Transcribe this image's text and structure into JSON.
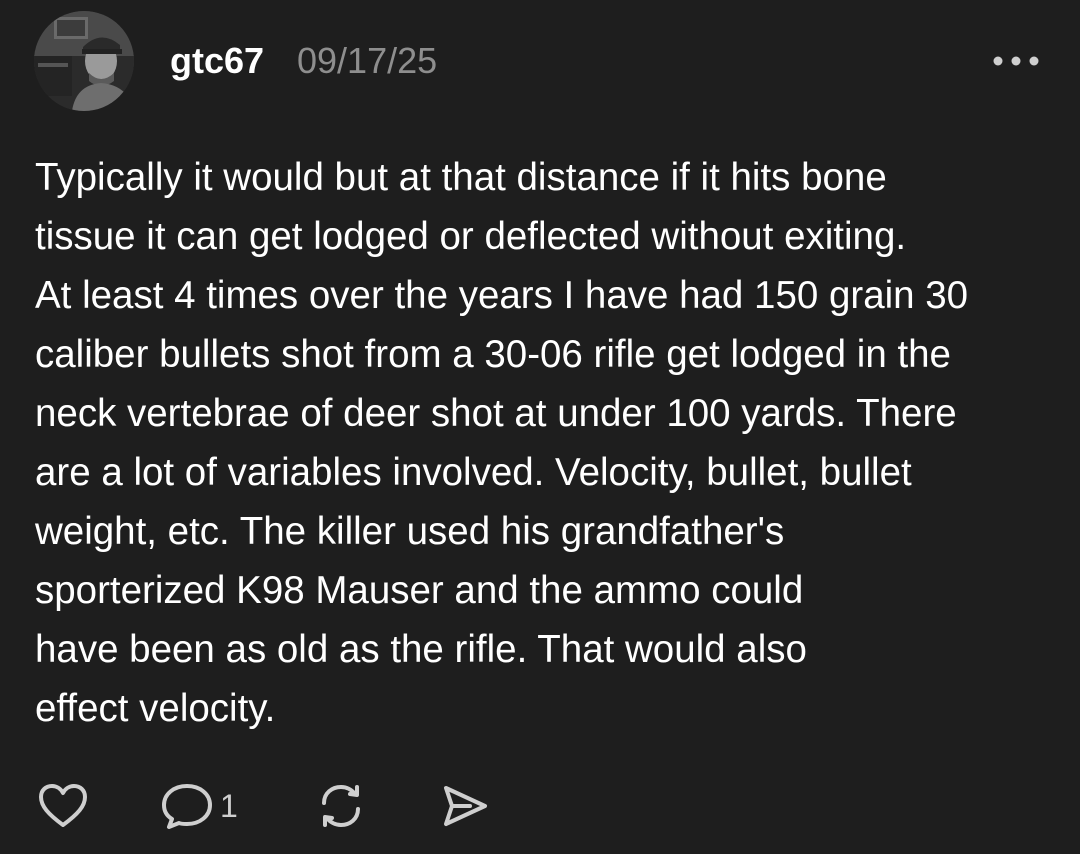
{
  "post": {
    "username": "gtc67",
    "date": "09/17/25",
    "body_lines": [
      "Typically it would but at that distance if it hits bone",
      "tissue it can get lodged or deflected without exiting.",
      "At least 4 times over the years I have had 150 grain 30",
      "caliber bullets shot from a 30-06 rifle get lodged in the",
      "neck vertebrae of deer shot at under 100 yards. There",
      "are a lot of variables involved. Velocity, bullet, bullet",
      "weight, etc. The killer used his grandfather's",
      "sporterized K98 Mauser and the ammo could",
      "have been as old as the rifle. That would also",
      "effect velocity."
    ],
    "reply_count": "1"
  },
  "icons": {
    "more": "more-horizontal-icon",
    "like": "heart-icon",
    "reply": "comment-icon",
    "repost": "repost-icon",
    "share": "send-icon"
  },
  "colors": {
    "background": "#1e1e1e",
    "text": "#ffffff",
    "muted": "#8e8e8e",
    "icon": "#cfcfcf"
  }
}
